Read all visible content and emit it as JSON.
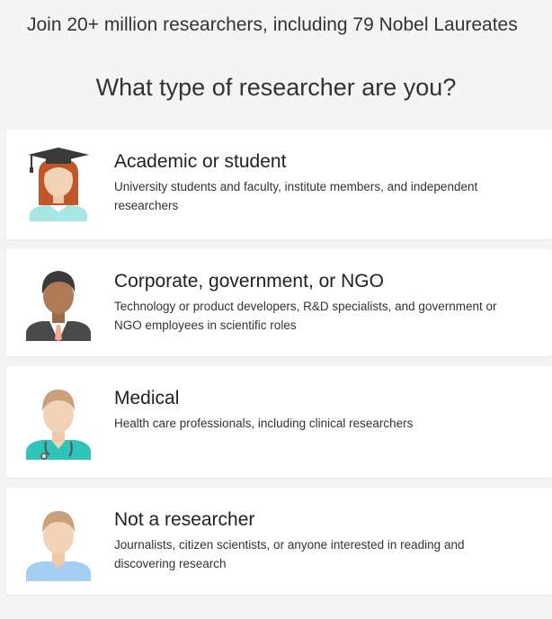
{
  "header": {
    "headline": "Join 20+ million researchers, including 79 Nobel Laureates",
    "question": "What type of researcher are you?"
  },
  "options": [
    {
      "title": "Academic or student",
      "description": "University students and faculty, institute members, and independent researchers",
      "icon": "academic-avatar-icon"
    },
    {
      "title": "Corporate, government, or NGO",
      "description": "Technology or product developers, R&D specialists, and government or NGO employees in scientific roles",
      "icon": "corporate-avatar-icon"
    },
    {
      "title": "Medical",
      "description": "Health care professionals, including clinical researchers",
      "icon": "medical-avatar-icon"
    },
    {
      "title": "Not a researcher",
      "description": "Journalists, citizen scientists, or anyone interested in reading and discovering research",
      "icon": "non-researcher-avatar-icon"
    }
  ]
}
